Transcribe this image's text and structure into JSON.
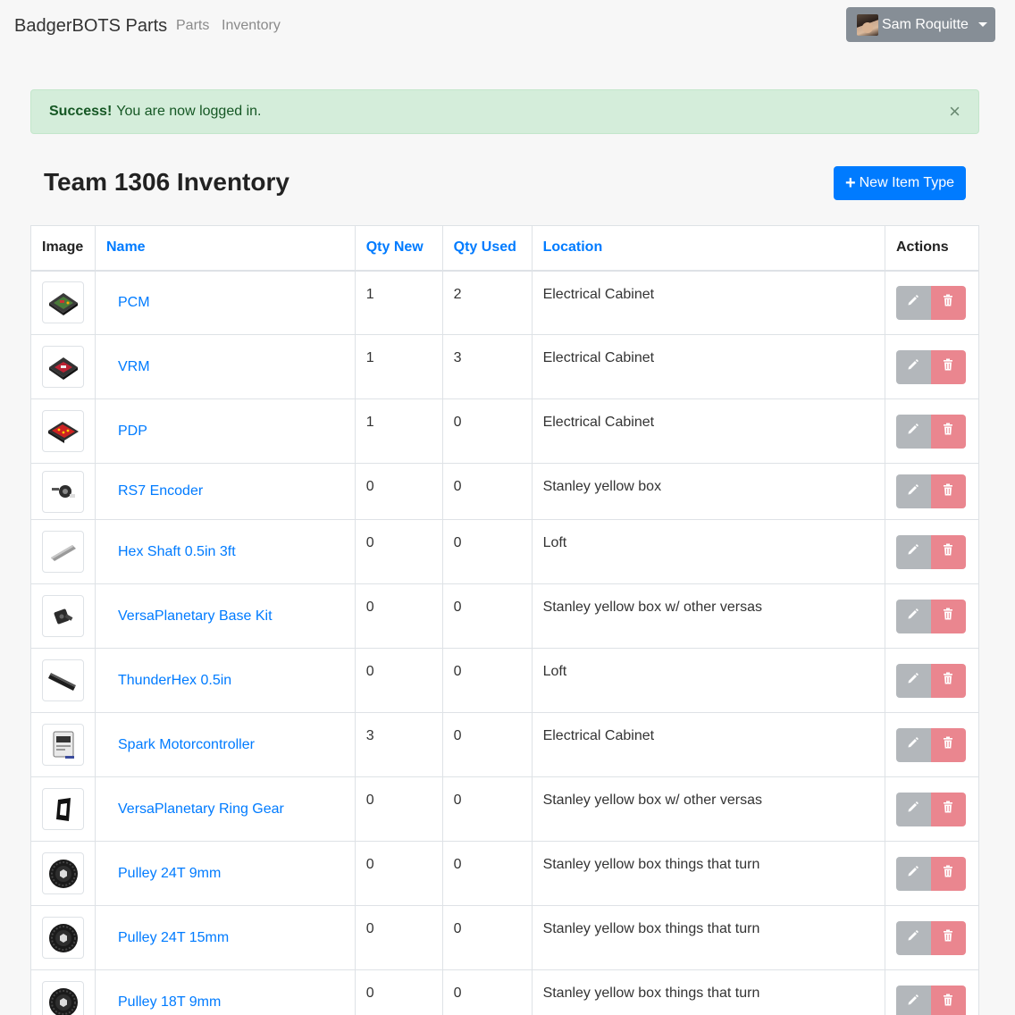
{
  "navbar": {
    "brand": "BadgerBOTS Parts",
    "links": [
      "Parts",
      "Inventory"
    ],
    "user": "Sam Roquitte"
  },
  "alert": {
    "strong": "Success!",
    "message": "You are now logged in.",
    "close": "×"
  },
  "page": {
    "title": "Team 1306 Inventory",
    "new_button": "New Item Type"
  },
  "table": {
    "headers": [
      "Image",
      "Name",
      "Qty New",
      "Qty Used",
      "Location",
      "Actions"
    ],
    "rows": [
      {
        "name": "PCM",
        "qty_new": "1",
        "qty_used": "2",
        "location": "Electrical Cabinet",
        "icon": "pcm-board-icon"
      },
      {
        "name": "VRM",
        "qty_new": "1",
        "qty_used": "3",
        "location": "Electrical Cabinet",
        "icon": "vrm-board-icon"
      },
      {
        "name": "PDP",
        "qty_new": "1",
        "qty_used": "0",
        "location": "Electrical Cabinet",
        "icon": "pdp-board-icon"
      },
      {
        "name": "RS7 Encoder",
        "qty_new": "0",
        "qty_used": "0",
        "location": "Stanley yellow box",
        "icon": "encoder-icon"
      },
      {
        "name": "Hex Shaft 0.5in 3ft",
        "qty_new": "0",
        "qty_used": "0",
        "location": "Loft",
        "icon": "hex-shaft-icon"
      },
      {
        "name": "VersaPlanetary Base Kit",
        "qty_new": "0",
        "qty_used": "0",
        "location": "Stanley yellow box w/ other versas",
        "icon": "gearbox-icon"
      },
      {
        "name": "ThunderHex 0.5in",
        "qty_new": "0",
        "qty_used": "0",
        "location": "Loft",
        "icon": "thunderhex-icon"
      },
      {
        "name": "Spark Motorcontroller",
        "qty_new": "3",
        "qty_used": "0",
        "location": "Electrical Cabinet",
        "icon": "spark-controller-icon"
      },
      {
        "name": "VersaPlanetary Ring Gear",
        "qty_new": "0",
        "qty_used": "0",
        "location": "Stanley yellow box w/ other versas",
        "icon": "ring-gear-icon"
      },
      {
        "name": "Pulley 24T 9mm",
        "qty_new": "0",
        "qty_used": "0",
        "location": "Stanley yellow box things that turn",
        "icon": "pulley-icon"
      },
      {
        "name": "Pulley 24T 15mm",
        "qty_new": "0",
        "qty_used": "0",
        "location": "Stanley yellow box things that turn",
        "icon": "pulley-icon"
      },
      {
        "name": "Pulley 18T 9mm",
        "qty_new": "0",
        "qty_used": "0",
        "location": "Stanley yellow box things that turn",
        "icon": "pulley-icon"
      }
    ]
  },
  "colors": {
    "primary": "#007bff",
    "success_bg": "#d4edda",
    "success_text": "#155724",
    "edit_button": "#b3b7bb",
    "delete_button": "#ea868f",
    "user_button": "#868e96"
  }
}
